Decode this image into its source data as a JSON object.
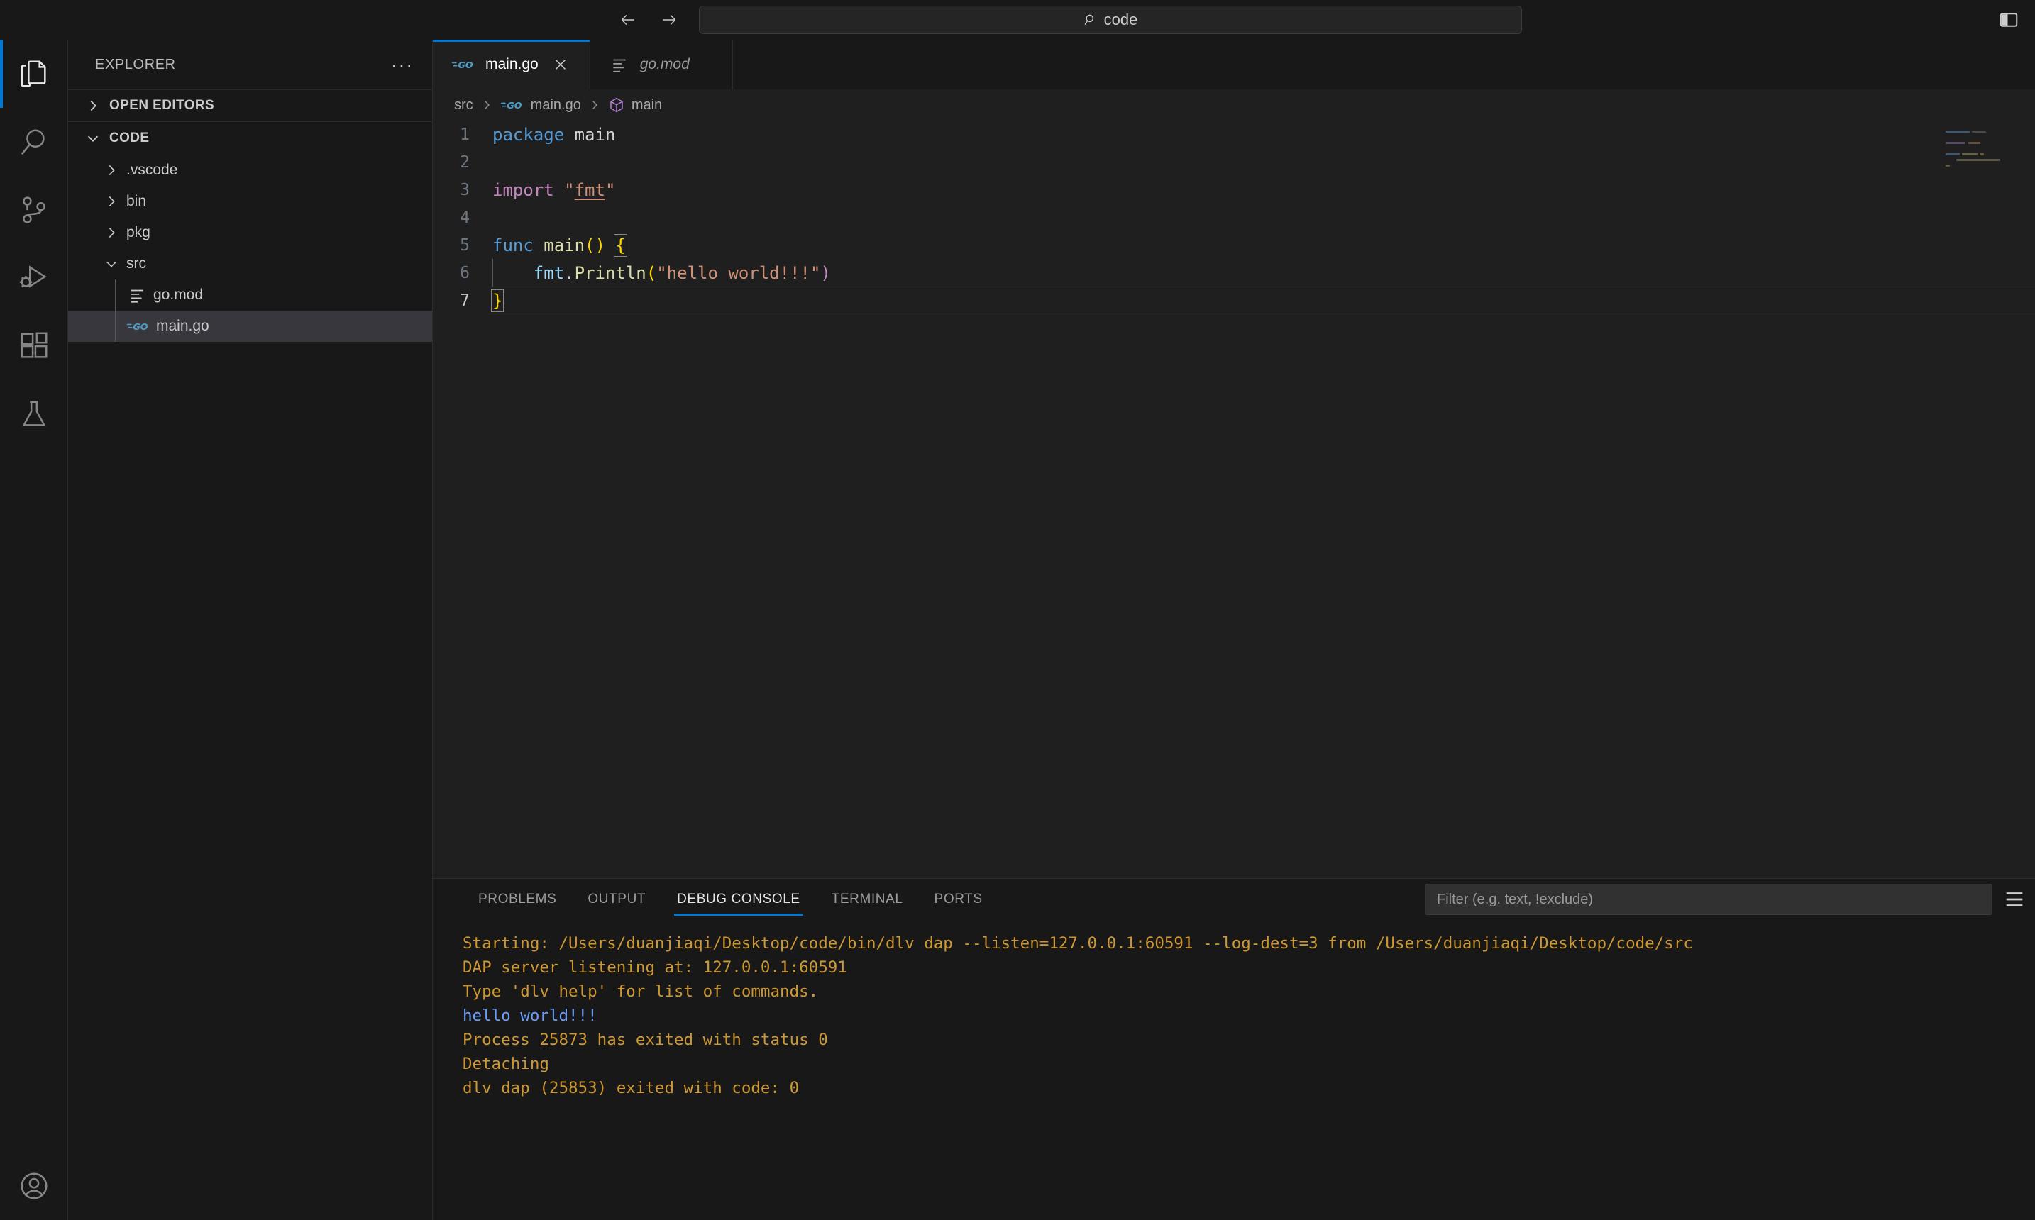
{
  "titlebar": {
    "back_icon": "arrow-left-icon",
    "forward_icon": "arrow-right-icon",
    "command_center_value": "code",
    "command_center_icon": "search-icon",
    "layout_toggle_icon": "layout-panel-icon"
  },
  "activitybar": {
    "items": [
      {
        "name": "explorer",
        "icon": "files-icon",
        "active": true
      },
      {
        "name": "search",
        "icon": "search-icon",
        "active": false
      },
      {
        "name": "source-control",
        "icon": "source-control-icon",
        "active": false
      },
      {
        "name": "run-and-debug",
        "icon": "run-debug-icon",
        "active": false
      },
      {
        "name": "extensions",
        "icon": "extensions-icon",
        "active": false
      },
      {
        "name": "testing",
        "icon": "beaker-icon",
        "active": false
      }
    ],
    "account": {
      "name": "account",
      "icon": "account-circle-icon"
    }
  },
  "sidebar": {
    "title": "EXPLORER",
    "more_actions": "···",
    "sections": [
      {
        "label": "OPEN EDITORS",
        "expanded": false
      },
      {
        "label": "CODE",
        "expanded": true
      }
    ],
    "tree": [
      {
        "label": ".vscode",
        "type": "folder",
        "expanded": false,
        "depth": 1,
        "selected": false
      },
      {
        "label": "bin",
        "type": "folder",
        "expanded": false,
        "depth": 1,
        "selected": false
      },
      {
        "label": "pkg",
        "type": "folder",
        "expanded": false,
        "depth": 1,
        "selected": false
      },
      {
        "label": "src",
        "type": "folder",
        "expanded": true,
        "depth": 1,
        "selected": false
      },
      {
        "label": "go.mod",
        "type": "file-mod",
        "expanded": null,
        "depth": 2,
        "selected": false
      },
      {
        "label": "main.go",
        "type": "file-go",
        "expanded": null,
        "depth": 2,
        "selected": true
      }
    ]
  },
  "editor": {
    "tabs": [
      {
        "label": "main.go",
        "icon": "go-file-icon",
        "active": true,
        "preview": false,
        "close_icon": "close-icon"
      },
      {
        "label": "go.mod",
        "icon": "mod-file-icon",
        "active": false,
        "preview": true
      }
    ],
    "breadcrumb": [
      {
        "label": "src",
        "icon": null
      },
      {
        "label": "main.go",
        "icon": "go-file-icon"
      },
      {
        "label": "main",
        "icon": "symbol-package-icon"
      }
    ],
    "line_numbers": [
      "1",
      "2",
      "3",
      "4",
      "5",
      "6",
      "7"
    ],
    "code": {
      "l1_kw": "package",
      "l1_name": " main",
      "l3_kw": "import",
      "l3_quote_open": " \"",
      "l3_pkg": "fmt",
      "l3_quote_close": "\"",
      "l5_kw": "func",
      "l5_name": " main",
      "l5_parens": "()",
      "l5_brace": "{",
      "l6_indent": "    ",
      "l6_obj": "fmt",
      "l6_dot": ".",
      "l6_fn": "Println",
      "l6_paren_open": "(",
      "l6_str": "\"hello world!!!\"",
      "l6_paren_close": ")",
      "l7_brace": "}"
    },
    "cursor_line": 7
  },
  "panel": {
    "tabs": [
      {
        "label": "PROBLEMS",
        "active": false
      },
      {
        "label": "OUTPUT",
        "active": false
      },
      {
        "label": "DEBUG CONSOLE",
        "active": true
      },
      {
        "label": "TERMINAL",
        "active": false
      },
      {
        "label": "PORTS",
        "active": false
      }
    ],
    "filter_placeholder": "Filter (e.g. text, !exclude)",
    "filter_value": "",
    "menu_icon": "list-menu-icon",
    "console_lines": [
      {
        "text": "Starting: /Users/duanjiaqi/Desktop/code/bin/dlv dap --listen=127.0.0.1:60591 --log-dest=3 from /Users/duanjiaqi/Desktop/code/src",
        "color": "yellow"
      },
      {
        "text": "DAP server listening at: 127.0.0.1:60591",
        "color": "yellow"
      },
      {
        "text": "Type 'dlv help' for list of commands.",
        "color": "yellow"
      },
      {
        "text": "hello world!!!",
        "color": "blue"
      },
      {
        "text": "Process 25873 has exited with status 0",
        "color": "yellow"
      },
      {
        "text": "Detaching",
        "color": "yellow"
      },
      {
        "text": "dlv dap (25853) exited with code: 0",
        "color": "yellow"
      }
    ]
  },
  "colors": {
    "accent": "#0078d4",
    "titlebar_bg": "#181818",
    "editor_bg": "#1f1f1f",
    "selection_bg": "#37373d",
    "console_yellow": "#cd9731",
    "console_blue": "#6c9ef8",
    "go_icon_blue": "#4a9cc7"
  }
}
